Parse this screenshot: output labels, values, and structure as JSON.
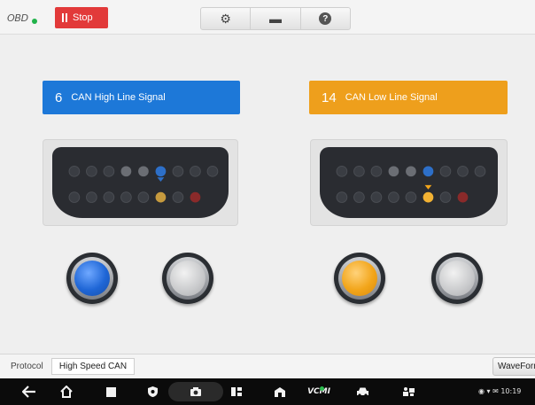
{
  "header": {
    "obd_label": "OBD",
    "stop_label": "Stop",
    "tools": [
      {
        "icon": "gear-icon",
        "glyph": "⚙"
      },
      {
        "icon": "folder-icon",
        "glyph": "▬"
      },
      {
        "icon": "help-icon",
        "glyph": "?"
      }
    ]
  },
  "signals": [
    {
      "pin": "6",
      "label": "CAN High Line Signal",
      "color": "#1d78d8"
    },
    {
      "pin": "14",
      "label": "CAN Low Line Signal",
      "color": "#ee9f1c"
    }
  ],
  "lamps": {
    "high_active_color": "#1f66d6",
    "low_active_color": "#f2a51a",
    "inactive_color": "#c8c9cb"
  },
  "status": {
    "protocol_label": "Protocol",
    "protocol_value": "High Speed CAN",
    "waveform_label": "WaveForm"
  },
  "navbar": {
    "vcmi_label": "VCMI",
    "tray_text": "◉ ▾ ✉ 10:19"
  }
}
